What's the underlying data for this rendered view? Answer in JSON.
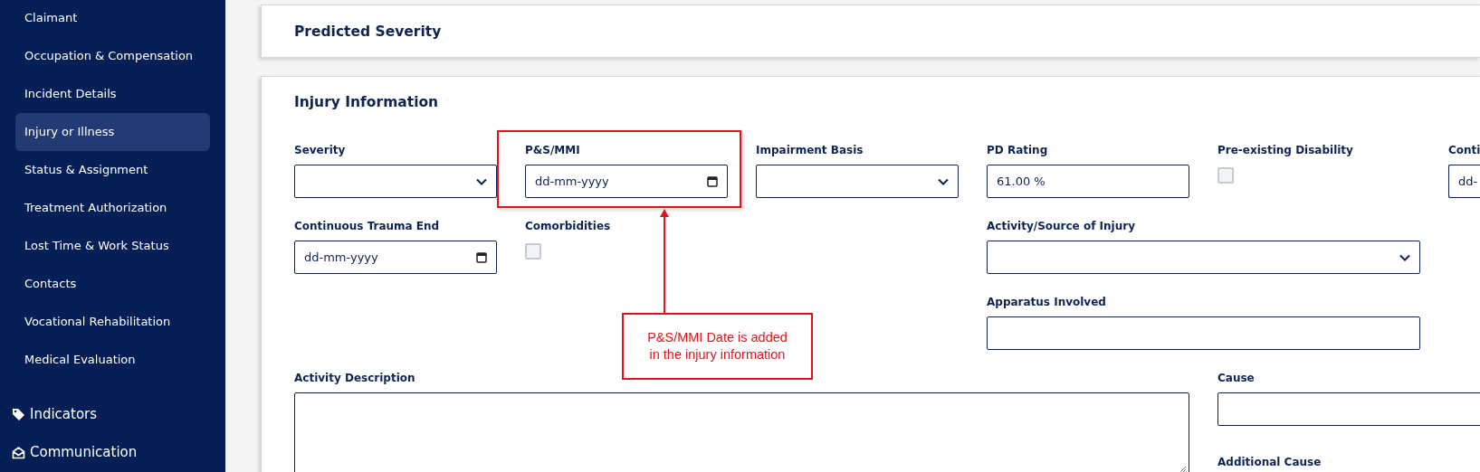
{
  "sidebar": {
    "items": [
      {
        "label": "Claimant",
        "selected": false
      },
      {
        "label": "Occupation & Compensation",
        "selected": false
      },
      {
        "label": "Incident Details",
        "selected": false
      },
      {
        "label": "Injury or Illness",
        "selected": true
      },
      {
        "label": "Status & Assignment",
        "selected": false
      },
      {
        "label": "Treatment Authorization",
        "selected": false
      },
      {
        "label": "Lost Time & Work Status",
        "selected": false
      },
      {
        "label": "Contacts",
        "selected": false
      },
      {
        "label": "Vocational Rehabilitation",
        "selected": false
      },
      {
        "label": "Medical Evaluation",
        "selected": false
      }
    ],
    "sections": [
      {
        "label": "Indicators",
        "kind": "tag"
      },
      {
        "label": "Communication",
        "kind": "envelope"
      }
    ]
  },
  "predicted_severity": {
    "title": "Predicted Severity"
  },
  "injury_information": {
    "title": "Injury Information",
    "fields": [
      {
        "label": "Severity",
        "kind": "select"
      },
      {
        "label": "P&S/MMI",
        "kind": "date",
        "placeholder": "dd-mm-yyyy"
      },
      {
        "label": "Impairment Basis",
        "kind": "select"
      },
      {
        "label": "PD Rating",
        "kind": "text",
        "value": "61.00 %"
      },
      {
        "label": "Pre-existing Disability",
        "kind": "checkbox",
        "checked": false
      },
      {
        "label": "Conti",
        "kind": "date",
        "placeholder": "dd-"
      },
      {
        "label": "Continuous Trauma End",
        "kind": "date",
        "placeholder": "dd-mm-yyyy"
      },
      {
        "label": "Comorbidities",
        "kind": "checkbox",
        "checked": false
      },
      {
        "label": "Activity/Source of Injury",
        "kind": "select"
      },
      {
        "label": "Apparatus Involved",
        "kind": "text"
      },
      {
        "label": "Activity Description",
        "kind": "textarea"
      },
      {
        "label": "Cause",
        "kind": "text"
      },
      {
        "label": "Additional Cause",
        "kind": "label"
      }
    ]
  },
  "annotation": {
    "lines": [
      "P&S/MMI Date is added",
      "in the injury information"
    ]
  }
}
